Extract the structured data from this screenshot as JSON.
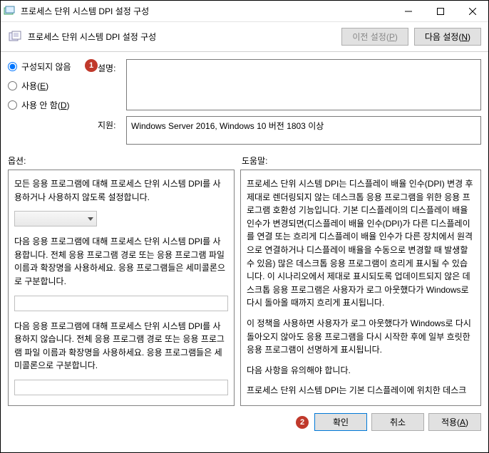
{
  "window": {
    "title": "프로세스 단위 시스템 DPI 설정 구성"
  },
  "header": {
    "title": "프로세스 단위 시스템 DPI 설정 구성",
    "prev_label": "이전 설정",
    "prev_accel": "P",
    "next_label": "다음 설정",
    "next_accel": "N"
  },
  "radios": {
    "not_configured": "구성되지 않음",
    "enabled": "사용",
    "enabled_accel": "E",
    "disabled": "사용 안 함",
    "disabled_accel": "D",
    "badge1": "1"
  },
  "desc": {
    "label": "설명:",
    "value": "",
    "support_label": "지원:",
    "support_value": "Windows Server 2016, Windows 10 버전 1803 이상"
  },
  "section_labels": {
    "options": "옵션:",
    "help": "도움말:"
  },
  "options_panel": {
    "p1": "모든 응용 프로그램에 대해 프로세스 단위 시스템 DPI를 사용하거나 사용하지 않도록 설정합니다.",
    "p2": "다음 응용 프로그램에 대해 프로세스 단위 시스템 DPI를 사용합니다. 전체 응용 프로그램 경로 또는 응용 프로그램 파일 이름과 확장명을 사용하세요. 응용 프로그램들은 세미콜론으로 구분합니다.",
    "p3": "다음 응용 프로그램에 대해 프로세스 단위 시스템 DPI를 사용하지 않습니다. 전체 응용 프로그램 경로 또는 응용 프로그램 파일 이름과 확장명을 사용하세요. 응용 프로그램들은 세미콜론으로 구분합니다."
  },
  "help_panel": {
    "p1": "프로세스 단위 시스템 DPI는 디스플레이 배율 인수(DPI) 변경 후 제대로 렌더링되지 않는 데스크톱 응용 프로그램을 위한 응용 프로그램 호환성 기능입니다. 기본 디스플레이의 디스플레이 배율 인수가 변경되면(디스플레이 배율 인수(DPI)가 다른 디스플레이를 연결 또는 흐리게 디스플레이 배율 인수가 다른 장치에서 원격으로 연결하거나 디스플레이 배율을 수동으로 변경할 때 발생할 수 있음) 많은 데스크톱 응용 프로그램이 흐리게 표시될 수 있습니다. 이 시나리오에서 제대로 표시되도록 업데이트되지 않은 데스크톱 응용 프로그램은 사용자가 로그 아웃했다가 Windows로 다시 돌아올 때까지 흐리게 표시됩니다.",
    "p2": "이 정책을 사용하면 사용자가 로그 아웃했다가 Windows로 다시 돌아오지 않아도 응용 프로그램을 다시 시작한 후에 일부 흐릿한 응용 프로그램이 선명하게 표시됩니다.",
    "p3": "다음 사항을 유의해야 합니다.",
    "p4": "프로세스 단위 시스템 DPI는 기본 디스플레이에 위치한 데스크톱 응용 프로그램의 렌더링만 개선합니다. 일부 데스크톱 응용 프로그램은 디스플레이 배율 인수가 다른 보조 디스플레이에서 여전히 흐리게 표시될 수 있습니다."
  },
  "footer": {
    "badge2": "2",
    "ok": "확인",
    "cancel": "취소",
    "apply": "적용",
    "apply_accel": "A"
  }
}
